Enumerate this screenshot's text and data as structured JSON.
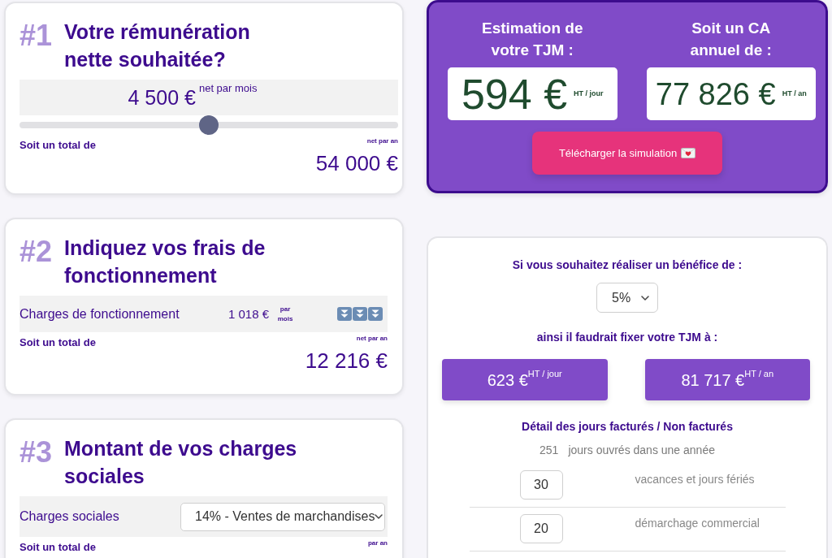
{
  "steps": [
    {
      "kind": "slider",
      "number": "#1",
      "title": "Votre rémunération nette souhaitée?",
      "amount": "4 500 €",
      "amount_unit": "net par mois",
      "level": 0.5,
      "total_label": "Soit un total de",
      "total_unit": "net par an",
      "total": "54 000 €"
    },
    {
      "kind": "amount",
      "number": "#2",
      "title": "Indiquez vos frais de fonctionnement",
      "label": "Charges de fonctionnement",
      "amount": "1 018 €",
      "amount_unit": "par mois",
      "total_label": "Soit un total de",
      "total_unit": "net par an",
      "total": "12 216 €"
    },
    {
      "kind": "select",
      "number": "#3",
      "title": "Montant de vos charges sociales",
      "label": "Charges sociales",
      "select": "14% - Ventes de marchandises",
      "total_label": "Soit un total de",
      "total_unit": "par an"
    }
  ],
  "estimate": {
    "items": [
      {
        "label": "Estimation de votre TJM :",
        "value": "594 €",
        "unit": "HT / jour"
      },
      {
        "label": "Soit un CA annuel de :",
        "value": "77 826 €",
        "unit": "HT / an"
      }
    ],
    "download_button": "Télécharger la simulation"
  },
  "profit": {
    "question": "Si vous souhaitez réaliser un bénéfice de :",
    "select": "5%",
    "result_label": "ainsi il faudrait fixer votre TJM à :",
    "results": [
      {
        "value": "623 €",
        "unit": "HT / jour"
      },
      {
        "value": "81 717 €",
        "unit": "HT / an"
      }
    ],
    "days_title": "Détail des jours facturés / Non facturés",
    "working_days": {
      "value": "251",
      "label": "jours ouvrés dans une année"
    },
    "day_rows": [
      {
        "value": "30",
        "label": "vacances et jours fériés"
      },
      {
        "value": "20",
        "label": "démarchage commercial"
      }
    ]
  }
}
